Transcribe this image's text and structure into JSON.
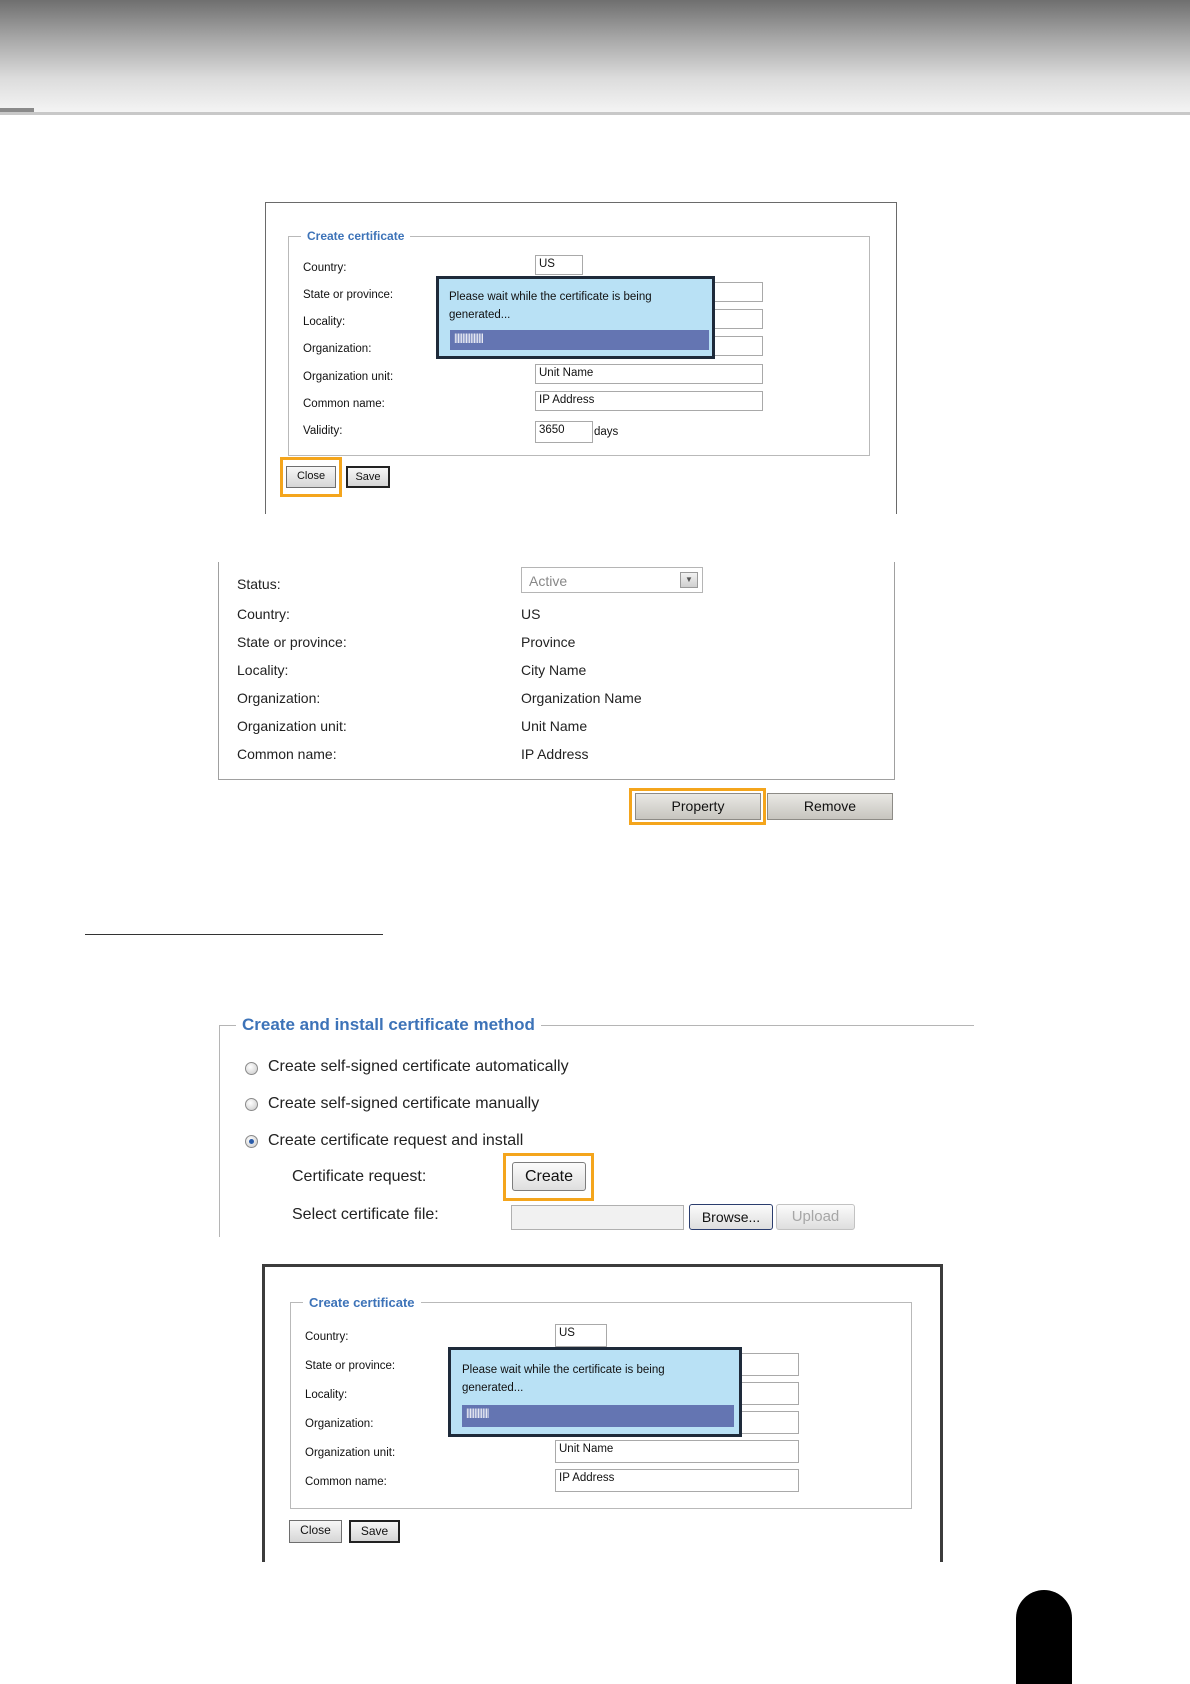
{
  "panel1": {
    "legend": "Create certificate",
    "labels": [
      "Country:",
      "State or province:",
      "Locality:",
      "Organization:",
      "Organization unit:",
      "Common name:",
      "Validity:"
    ],
    "country_value": "US",
    "org_unit_value": "Unit Name",
    "common_name_value": "IP Address",
    "validity_value": "3650",
    "validity_unit": "days",
    "popup_message": "Please wait while the certificate is being generated...",
    "progress_text": "||||||||||||||||||",
    "close_label": "Close",
    "save_label": "Save"
  },
  "panel2": {
    "labels": [
      "Status:",
      "Country:",
      "State or province:",
      "Locality:",
      "Organization:",
      "Organization unit:",
      "Common name:"
    ],
    "status_value": "Active",
    "values": [
      "US",
      "Province",
      "City Name",
      "Organization Name",
      "Unit Name",
      "IP Address"
    ],
    "property_label": "Property",
    "remove_label": "Remove"
  },
  "panel3": {
    "legend": "Create and install certificate method",
    "options": [
      "Create self-signed certificate automatically",
      "Create self-signed certificate manually",
      "Create certificate request and install"
    ],
    "selected_option_index": 2,
    "cert_request_label": "Certificate request:",
    "create_label": "Create",
    "select_file_label": "Select certificate file:",
    "browse_label": "Browse...",
    "upload_label": "Upload"
  },
  "panel4": {
    "legend": "Create certificate",
    "labels": [
      "Country:",
      "State or province:",
      "Locality:",
      "Organization:",
      "Organization unit:",
      "Common name:"
    ],
    "country_value": "US",
    "org_unit_value": "Unit Name",
    "common_name_value": "IP Address",
    "popup_message": "Please wait while the certificate is being generated...",
    "progress_text": "||||||||||||||",
    "close_label": "Close",
    "save_label": "Save"
  }
}
